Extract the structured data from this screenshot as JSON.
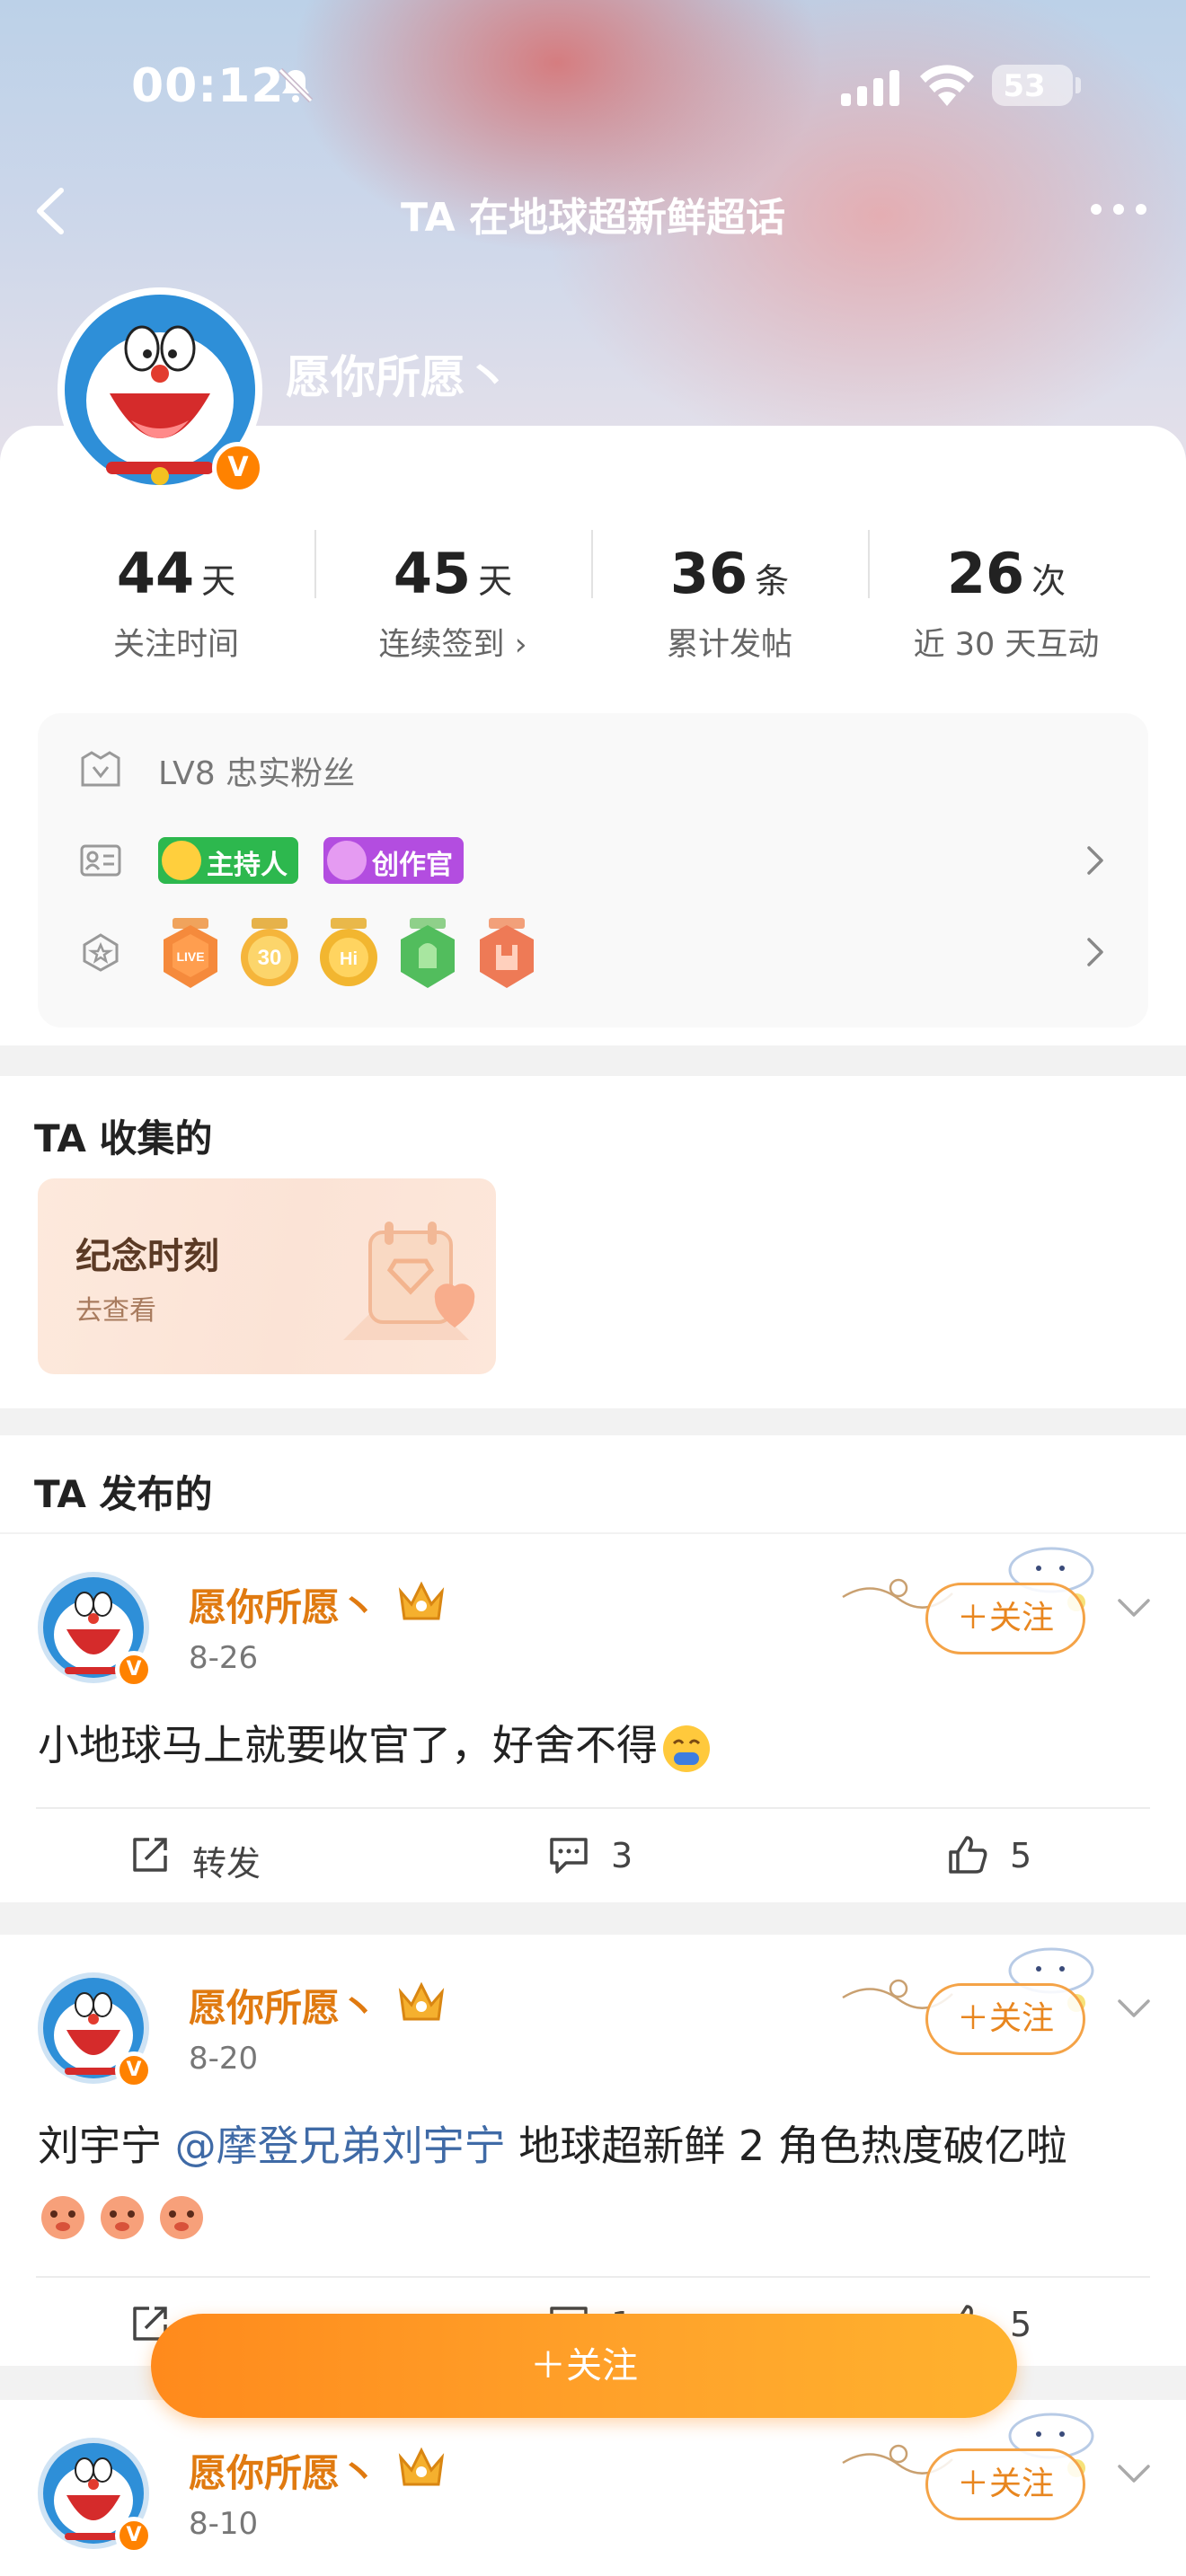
{
  "status_bar": {
    "time": "00:12",
    "battery": "53"
  },
  "nav": {
    "title": "TA 在地球超新鲜超话"
  },
  "profile": {
    "name": "愿你所愿丶",
    "verified_badge": "V"
  },
  "stats": [
    {
      "value": "44",
      "unit": "天",
      "label": "关注时间"
    },
    {
      "value": "45",
      "unit": "天",
      "label": "连续签到 ›"
    },
    {
      "value": "36",
      "unit": "条",
      "label": "累计发帖"
    },
    {
      "value": "26",
      "unit": "次",
      "label": "近 30 天互动"
    }
  ],
  "fan": {
    "level": "LV8 忠实粉丝",
    "tags": {
      "host": "主持人",
      "creator": "创作官"
    },
    "medal_count": 5
  },
  "collected": {
    "title": "TA 收集的",
    "card_title": "纪念时刻",
    "card_sub": "去查看"
  },
  "published": {
    "title": "TA 发布的"
  },
  "posts": [
    {
      "author": "愿你所愿丶",
      "date": "8-26",
      "text": "小地球马上就要收官了，好舍不得",
      "follow": "＋关注",
      "repost": "转发",
      "comments": "3",
      "likes": "5"
    },
    {
      "author": "愿你所愿丶",
      "date": "8-20",
      "text_prefix": "刘宇宁 ",
      "mention": "@摩登兄弟刘宇宁",
      "text_suffix": " 地球超新鲜 2 角色热度破亿啦",
      "follow": "＋关注",
      "repost": "转发",
      "comments": "1",
      "likes": "5"
    },
    {
      "author": "愿你所愿丶",
      "date": "8-10",
      "follow": "＋关注"
    }
  ],
  "float_follow": "＋关注",
  "colors": {
    "accent": "#ff8200",
    "follow_text": "#e8861f",
    "mention": "#3f6aa6"
  }
}
